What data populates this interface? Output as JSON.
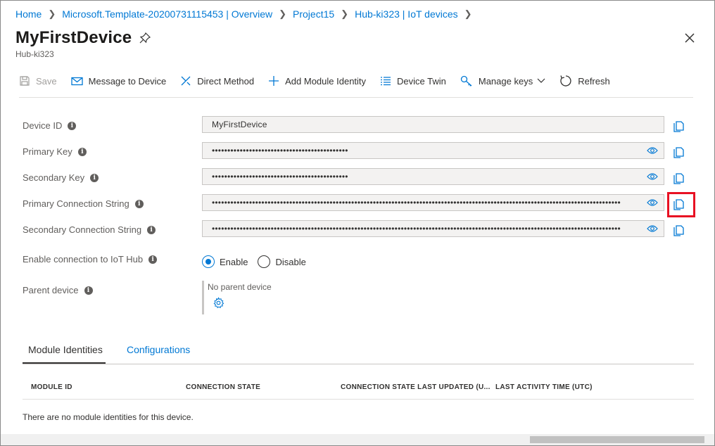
{
  "breadcrumb": {
    "items": [
      "Home",
      "Microsoft.Template-20200731115453 | Overview",
      "Project15",
      "Hub-ki323 | IoT devices"
    ]
  },
  "header": {
    "title": "MyFirstDevice",
    "subtitle": "Hub-ki323"
  },
  "toolbar": {
    "save": "Save",
    "message": "Message to Device",
    "direct_method": "Direct Method",
    "add_module": "Add Module Identity",
    "device_twin": "Device Twin",
    "manage_keys": "Manage keys",
    "refresh": "Refresh"
  },
  "fields": {
    "device_id": {
      "label": "Device ID",
      "value": "MyFirstDevice"
    },
    "primary_key": {
      "label": "Primary Key",
      "value": "••••••••••••••••••••••••••••••••••••••••••••"
    },
    "secondary_key": {
      "label": "Secondary Key",
      "value": "••••••••••••••••••••••••••••••••••••••••••••"
    },
    "primary_conn": {
      "label": "Primary Connection String",
      "value": "••••••••••••••••••••••••••••••••••••••••••••••••••••••••••••••••••••••••••••••••••••••••••••••••••••••••••••••••••••••••••••••••••••"
    },
    "secondary_conn": {
      "label": "Secondary Connection String",
      "value": "••••••••••••••••••••••••••••••••••••••••••••••••••••••••••••••••••••••••••••••••••••••••••••••••••••••••••••••••••••••••••••••••••••"
    }
  },
  "connection": {
    "label": "Enable connection to IoT Hub",
    "enable": "Enable",
    "disable": "Disable",
    "selected": "Enable"
  },
  "parent": {
    "label": "Parent device",
    "value": "No parent device"
  },
  "tabs": {
    "module_identities": "Module Identities",
    "configurations": "Configurations"
  },
  "table": {
    "columns": [
      "MODULE ID",
      "CONNECTION STATE",
      "CONNECTION STATE LAST UPDATED (U...",
      "LAST ACTIVITY TIME (UTC)"
    ],
    "empty": "There are no module identities for this device."
  },
  "colors": {
    "accent": "#0078d4",
    "highlight": "#e81123"
  }
}
